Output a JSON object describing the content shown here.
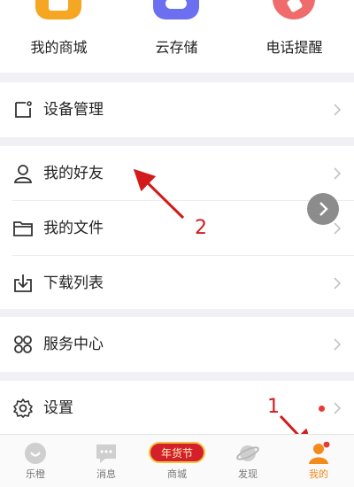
{
  "shortcuts": [
    {
      "label": "我的商城",
      "icon": "shop-icon",
      "color": "#f5a623"
    },
    {
      "label": "云存储",
      "icon": "cloud-storage-icon",
      "color": "#6b6ff0"
    },
    {
      "label": "电话提醒",
      "icon": "phone-icon",
      "color": "#f06b6b"
    }
  ],
  "menu": {
    "device": {
      "label": "设备管理",
      "icon": "device-icon"
    },
    "friends": {
      "label": "我的好友",
      "icon": "user-icon"
    },
    "files": {
      "label": "我的文件",
      "icon": "folder-icon"
    },
    "downloads": {
      "label": "下载列表",
      "icon": "download-icon"
    },
    "service": {
      "label": "服务中心",
      "icon": "service-icon"
    },
    "settings": {
      "label": "设置",
      "icon": "gear-icon",
      "has_red_dot": true
    }
  },
  "annotations": {
    "one": "1",
    "two": "2",
    "color": "#d21b1b"
  },
  "tabs": [
    {
      "label": "乐橙",
      "icon": "smile-icon"
    },
    {
      "label": "消息",
      "icon": "message-icon"
    },
    {
      "label": "商城",
      "icon": "festival-banner-icon",
      "banner_text": "年货节"
    },
    {
      "label": "发现",
      "icon": "planet-icon"
    },
    {
      "label": "我的",
      "icon": "me-icon",
      "active": true
    }
  ],
  "accent_color": "#f28a1c"
}
